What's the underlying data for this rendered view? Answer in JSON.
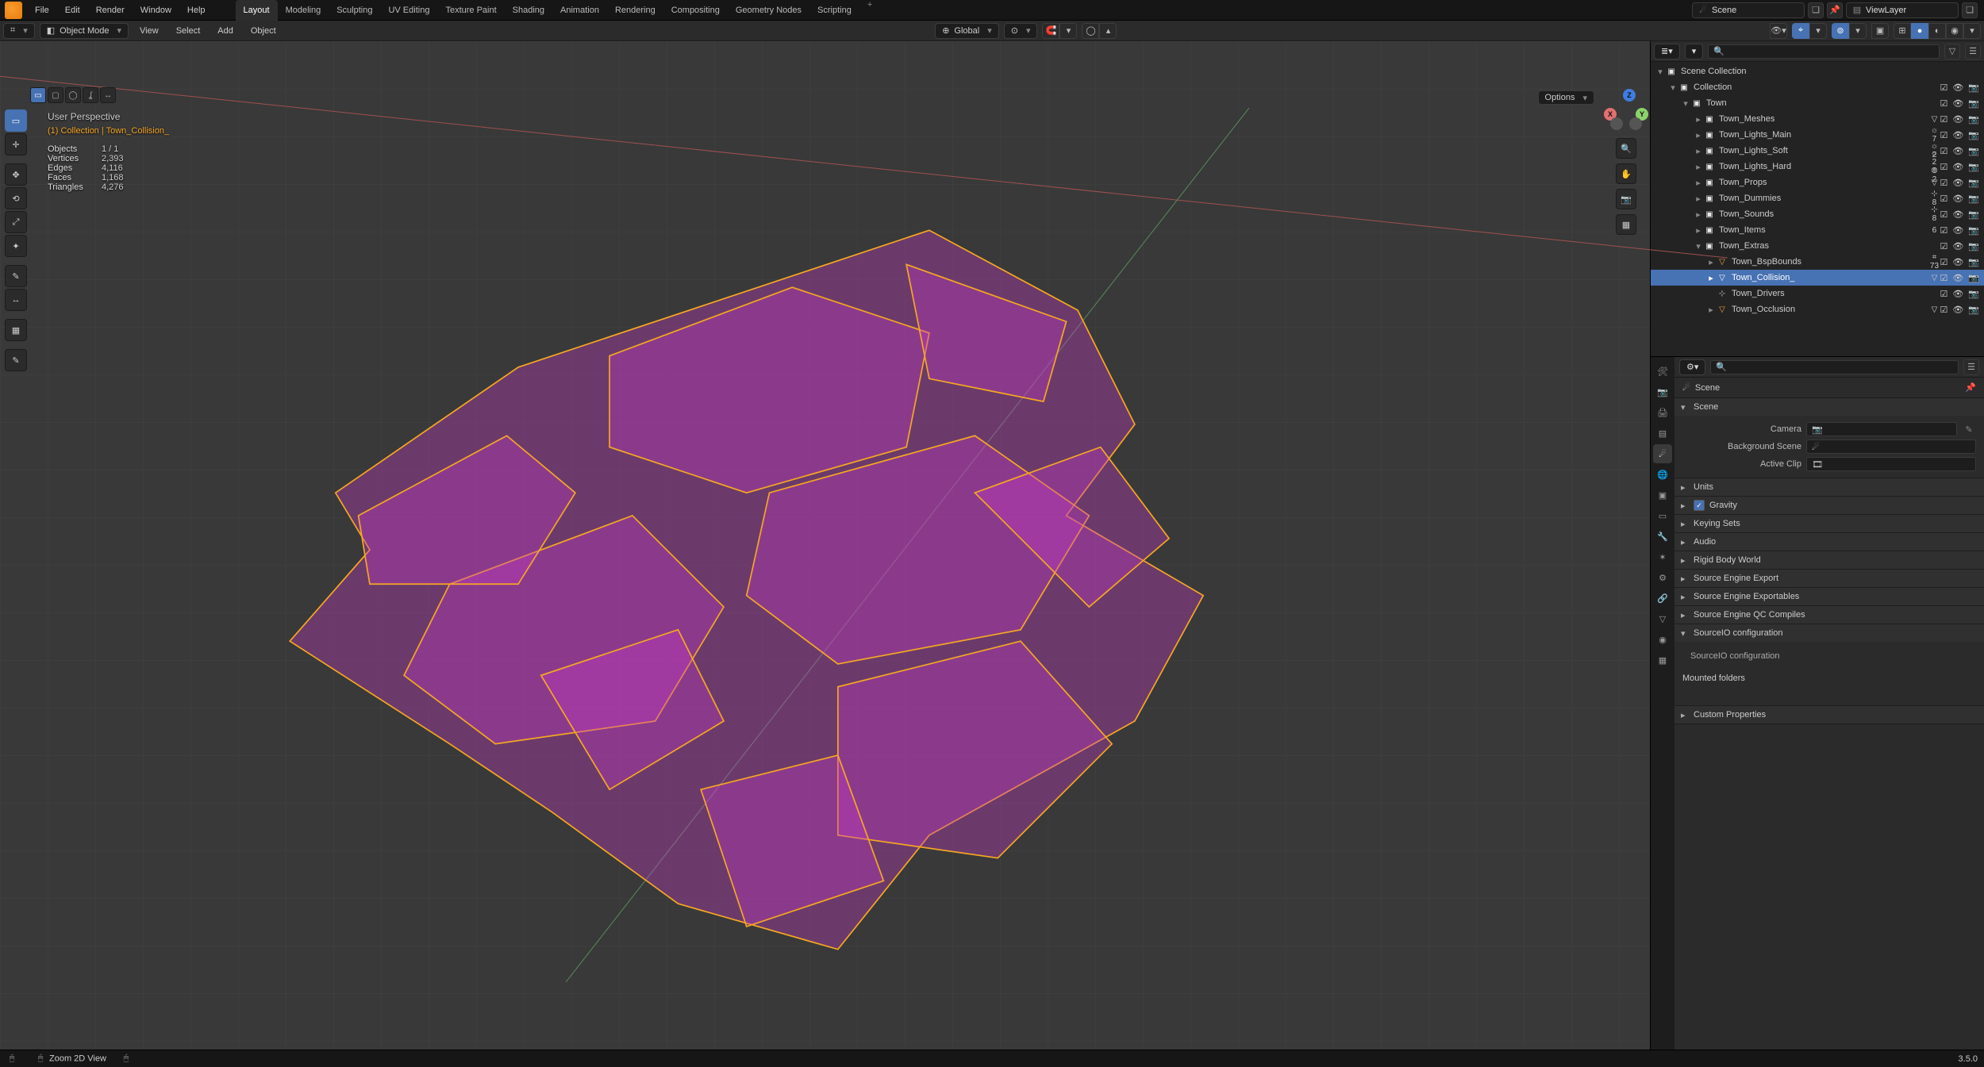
{
  "topmenu": [
    "File",
    "Edit",
    "Render",
    "Window",
    "Help"
  ],
  "workspaces": [
    "Layout",
    "Modeling",
    "Sculpting",
    "UV Editing",
    "Texture Paint",
    "Shading",
    "Animation",
    "Rendering",
    "Compositing",
    "Geometry Nodes",
    "Scripting"
  ],
  "active_workspace": "Layout",
  "top_right": {
    "scene_field": "Scene",
    "viewlayer_field": "ViewLayer"
  },
  "view3d_header": {
    "mode": "Object Mode",
    "menus": [
      "View",
      "Select",
      "Add",
      "Object"
    ],
    "orient": "Global",
    "options_label": "Options"
  },
  "overlay": {
    "perspective": "User Perspective",
    "context": "(1) Collection | Town_Collision_"
  },
  "stats": {
    "objects_l": "Objects",
    "objects_v": "1 / 1",
    "verts_l": "Vertices",
    "verts_v": "2,393",
    "edges_l": "Edges",
    "edges_v": "4,116",
    "faces_l": "Faces",
    "faces_v": "1,168",
    "tris_l": "Triangles",
    "tris_v": "4,276"
  },
  "gizmo": {
    "x": "X",
    "y": "Y",
    "z": "Z"
  },
  "outliner": {
    "root": "Scene Collection",
    "items": [
      {
        "depth": 1,
        "kind": "coll",
        "name": "Collection",
        "open": true
      },
      {
        "depth": 2,
        "kind": "coll",
        "name": "Town",
        "open": true
      },
      {
        "depth": 3,
        "kind": "coll",
        "name": "Town_Meshes",
        "badge": "▽"
      },
      {
        "depth": 3,
        "kind": "coll",
        "name": "Town_Lights_Main",
        "badge": "☼ 7"
      },
      {
        "depth": 3,
        "kind": "coll",
        "name": "Town_Lights_Soft",
        "badge": "☼ 2"
      },
      {
        "depth": 3,
        "kind": "coll",
        "name": "Town_Lights_Hard",
        "badge": "☼ 2 ⦾ 2"
      },
      {
        "depth": 3,
        "kind": "coll",
        "name": "Town_Props",
        "badge": "▽"
      },
      {
        "depth": 3,
        "kind": "coll",
        "name": "Town_Dummies",
        "badge": "⊹ 8"
      },
      {
        "depth": 3,
        "kind": "coll",
        "name": "Town_Sounds",
        "badge": "⊹ 8"
      },
      {
        "depth": 3,
        "kind": "coll",
        "name": "Town_Items",
        "badge": "6"
      },
      {
        "depth": 3,
        "kind": "coll",
        "name": "Town_Extras",
        "open": true
      },
      {
        "depth": 4,
        "kind": "mesh",
        "name": "Town_BspBounds",
        "badge": "⌗ 73"
      },
      {
        "depth": 4,
        "kind": "mesh",
        "name": "Town_Collision_",
        "badge": "▽",
        "selected": true
      },
      {
        "depth": 4,
        "kind": "empty",
        "name": "Town_Drivers"
      },
      {
        "depth": 4,
        "kind": "mesh",
        "name": "Town_Occlusion",
        "badge": "▽"
      }
    ]
  },
  "properties": {
    "breadcrumb": "Scene",
    "panel_scene": {
      "title": "Scene",
      "camera_l": "Camera",
      "bgscene_l": "Background Scene",
      "clip_l": "Active Clip"
    },
    "closed_panels": [
      "Units",
      "Keying Sets",
      "Audio",
      "Rigid Body World",
      "Source Engine Export",
      "Source Engine Exportables",
      "Source Engine QC Compiles"
    ],
    "gravity_label": "Gravity",
    "srcio_title": "SourceIO configuration",
    "srcio_sub": "SourceIO configuration",
    "mounted": "Mounted folders",
    "custom": "Custom Properties"
  },
  "statusbar": {
    "hint": "Zoom 2D View",
    "ver": "3.5.0"
  }
}
